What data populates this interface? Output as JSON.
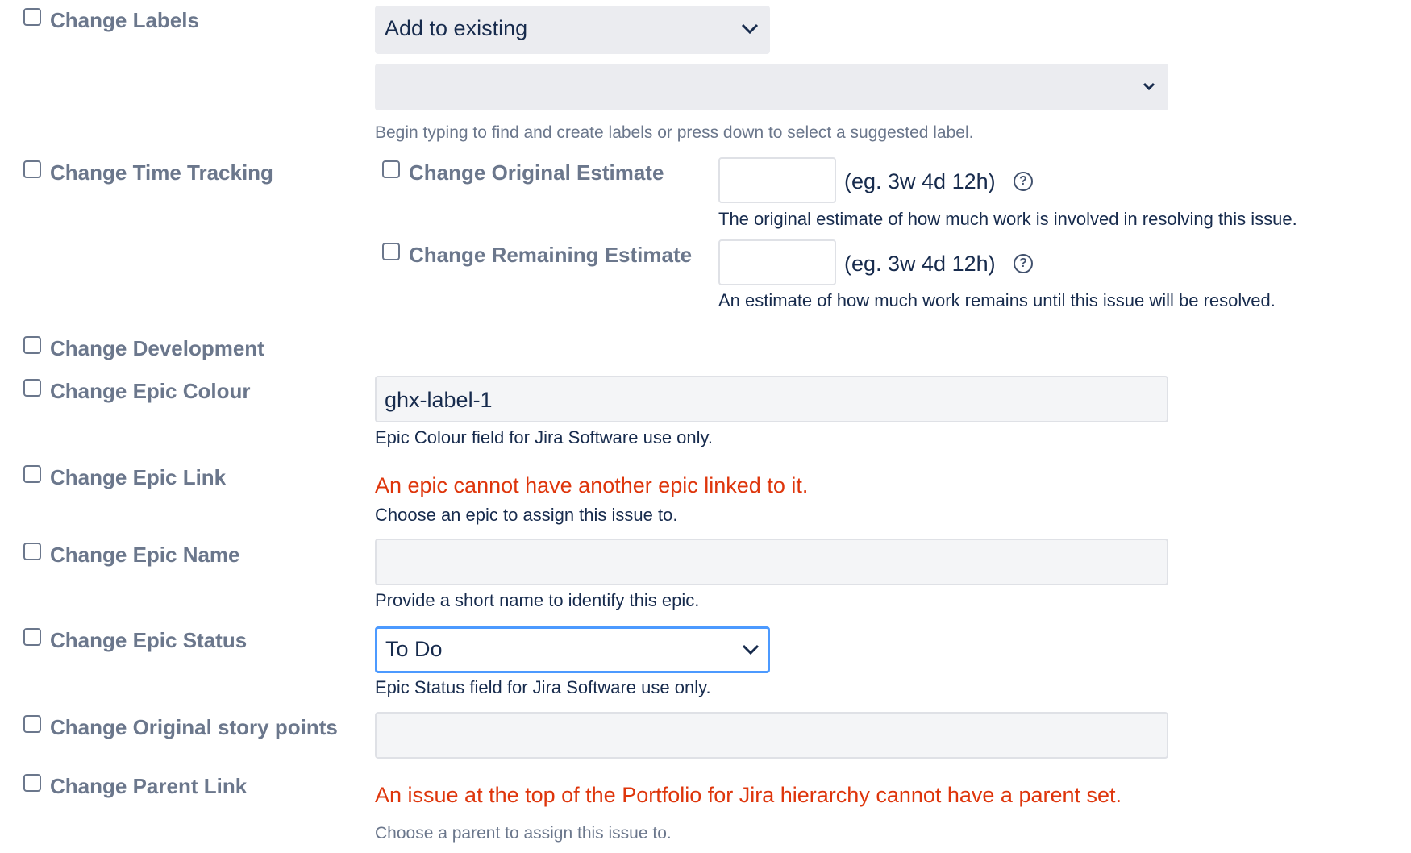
{
  "rows": {
    "labels": {
      "checkbox_label": "Change Labels",
      "mode_select": "Add to existing",
      "hint": "Begin typing to find and create labels or press down to select a suggested label."
    },
    "time_tracking": {
      "checkbox_label": "Change Time Tracking",
      "original": {
        "checkbox_label": "Change Original Estimate",
        "example": "(eg. 3w 4d 12h)",
        "description": "The original estimate of how much work is involved in resolving this issue."
      },
      "remaining": {
        "checkbox_label": "Change Remaining Estimate",
        "example": "(eg. 3w 4d 12h)",
        "description": "An estimate of how much work remains until this issue will be resolved."
      }
    },
    "development": {
      "checkbox_label": "Change Development"
    },
    "epic_colour": {
      "checkbox_label": "Change Epic Colour",
      "value": "ghx-label-1",
      "description": "Epic Colour field for Jira Software use only."
    },
    "epic_link": {
      "checkbox_label": "Change Epic Link",
      "error": "An epic cannot have another epic linked to it.",
      "description": "Choose an epic to assign this issue to."
    },
    "epic_name": {
      "checkbox_label": "Change Epic Name",
      "description": "Provide a short name to identify this epic."
    },
    "epic_status": {
      "checkbox_label": "Change Epic Status",
      "selected": "To Do",
      "description": "Epic Status field for Jira Software use only."
    },
    "original_story_points": {
      "checkbox_label": "Change Original story points"
    },
    "parent_link": {
      "checkbox_label": "Change Parent Link",
      "error": "An issue at the top of the Portfolio for Jira hierarchy cannot have a parent set.",
      "hint": "Choose a parent to assign this issue to."
    }
  },
  "help_glyph": "?",
  "colors": {
    "error": "#de350b",
    "focus": "#4c9aff",
    "label": "#6b778c"
  }
}
